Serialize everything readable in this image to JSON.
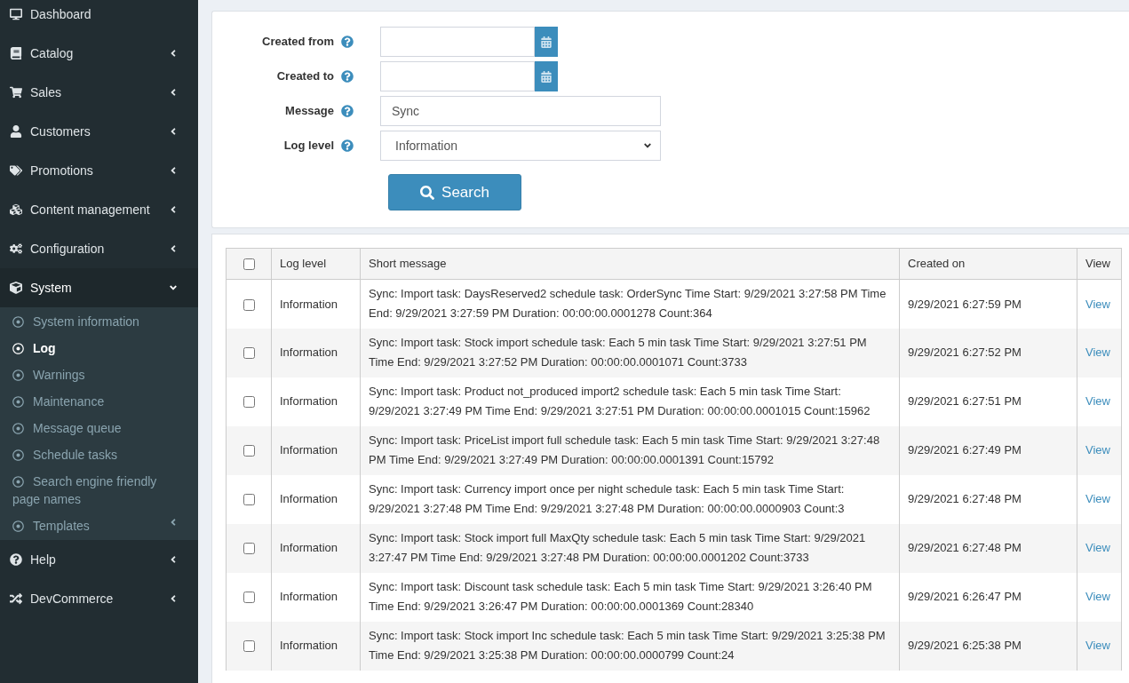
{
  "sidebar": {
    "items": [
      {
        "label": "Dashboard"
      },
      {
        "label": "Catalog",
        "expanded": false
      },
      {
        "label": "Sales",
        "expanded": false
      },
      {
        "label": "Customers",
        "expanded": false
      },
      {
        "label": "Promotions",
        "expanded": false
      },
      {
        "label": "Content management",
        "expanded": false
      },
      {
        "label": "Configuration",
        "expanded": false
      },
      {
        "label": "System",
        "expanded": true,
        "children": [
          {
            "label": "System information",
            "selected": false
          },
          {
            "label": "Log",
            "selected": true
          },
          {
            "label": "Warnings",
            "selected": false
          },
          {
            "label": "Maintenance",
            "selected": false
          },
          {
            "label": "Message queue",
            "selected": false
          },
          {
            "label": "Schedule tasks",
            "selected": false
          },
          {
            "label": "Search engine friendly page names",
            "selected": false
          },
          {
            "label": "Templates",
            "selected": false,
            "expanded": false
          }
        ]
      },
      {
        "label": "Help",
        "expanded": false
      },
      {
        "label": "DevCommerce",
        "expanded": false
      }
    ]
  },
  "search_form": {
    "fields": [
      {
        "kind": "date",
        "label": "Created from"
      },
      {
        "kind": "date",
        "label": "Created to"
      },
      {
        "kind": "text",
        "label": "Message",
        "value": "Sync"
      },
      {
        "kind": "select",
        "label": "Log level",
        "value": "Information"
      }
    ],
    "button": "Search"
  },
  "table": {
    "all_checked": false,
    "columns": [
      "Log level",
      "Short message",
      "Created on",
      "View"
    ],
    "rows": [
      {
        "checked": false,
        "level": "Information",
        "message": "Sync: Import task: DaysReserved2 schedule task: OrderSync Time Start: 9/29/2021 3:27:58 PM Time End: 9/29/2021 3:27:59 PM Duration: 00:00:00.0001278 Count:364",
        "created": "9/29/2021 6:27:59 PM",
        "view": "View"
      },
      {
        "checked": false,
        "level": "Information",
        "message": "Sync: Import task: Stock import schedule task: Each 5 min task Time Start: 9/29/2021 3:27:51 PM Time End: 9/29/2021 3:27:52 PM Duration: 00:00:00.0001071 Count:3733",
        "created": "9/29/2021 6:27:52 PM",
        "view": "View"
      },
      {
        "checked": false,
        "level": "Information",
        "message": "Sync: Import task: Product not_produced import2 schedule task: Each 5 min task Time Start: 9/29/2021 3:27:49 PM Time End: 9/29/2021 3:27:51 PM Duration: 00:00:00.0001015 Count:15962",
        "created": "9/29/2021 6:27:51 PM",
        "view": "View"
      },
      {
        "checked": false,
        "level": "Information",
        "message": "Sync: Import task: PriceList import full schedule task: Each 5 min task Time Start: 9/29/2021 3:27:48 PM Time End: 9/29/2021 3:27:49 PM Duration: 00:00:00.0001391 Count:15792",
        "created": "9/29/2021 6:27:49 PM",
        "view": "View"
      },
      {
        "checked": false,
        "level": "Information",
        "message": "Sync: Import task: Currency import once per night schedule task: Each 5 min task Time Start: 9/29/2021 3:27:48 PM Time End: 9/29/2021 3:27:48 PM Duration: 00:00:00.0000903 Count:3",
        "created": "9/29/2021 6:27:48 PM",
        "view": "View"
      },
      {
        "checked": false,
        "level": "Information",
        "message": "Sync: Import task: Stock import full MaxQty schedule task: Each 5 min task Time Start: 9/29/2021 3:27:47 PM Time End: 9/29/2021 3:27:48 PM Duration: 00:00:00.0001202 Count:3733",
        "created": "9/29/2021 6:27:48 PM",
        "view": "View"
      },
      {
        "checked": false,
        "level": "Information",
        "message": "Sync: Import task: Discount task schedule task: Each 5 min task Time Start: 9/29/2021 3:26:40 PM Time End: 9/29/2021 3:26:47 PM Duration: 00:00:00.0001369 Count:28340",
        "created": "9/29/2021 6:26:47 PM",
        "view": "View"
      },
      {
        "checked": false,
        "level": "Information",
        "message": "Sync: Import task: Stock import Inc schedule task: Each 5 min task Time Start: 9/29/2021 3:25:38 PM Time End: 9/29/2021 3:25:38 PM Duration: 00:00:00.0000799 Count:24",
        "created": "9/29/2021 6:25:38 PM",
        "view": "View"
      }
    ]
  }
}
